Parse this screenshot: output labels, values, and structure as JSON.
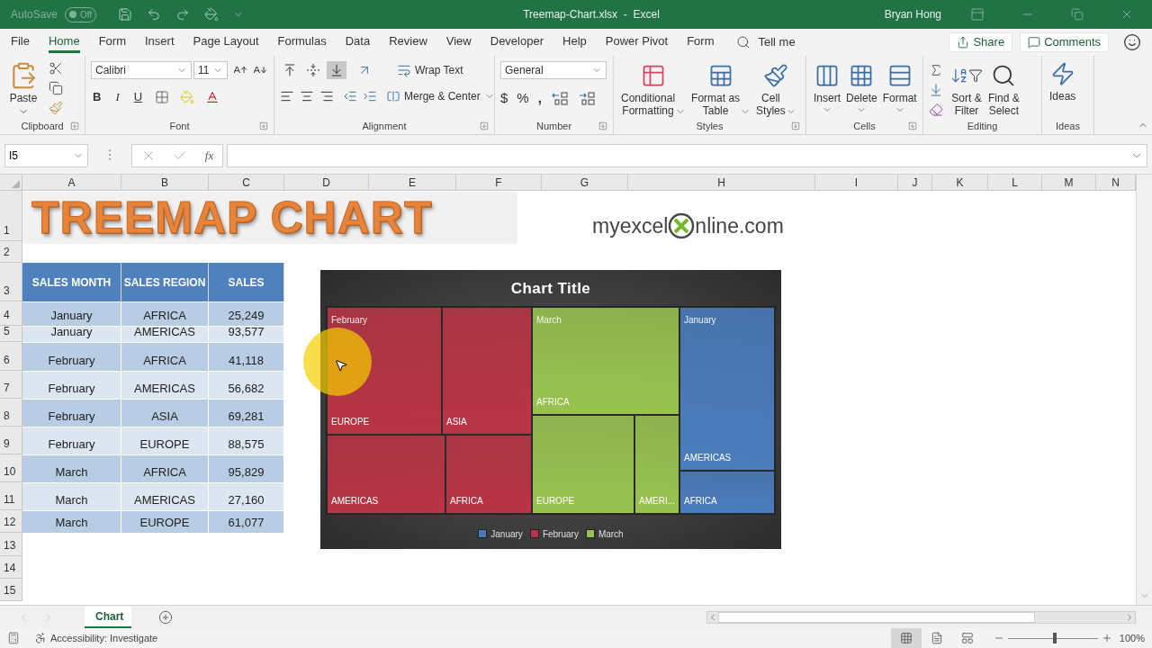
{
  "title_bar": {
    "autosave_label": "AutoSave",
    "autosave_toggle": {
      "text": "Off",
      "on": false
    },
    "title": "Treemap-Chart.xlsx  -  Excel",
    "user": "Bryan Hong"
  },
  "tabs": [
    {
      "label": "File",
      "selected": false
    },
    {
      "label": "Home",
      "selected": true
    },
    {
      "label": "Form",
      "selected": false
    },
    {
      "label": "Insert",
      "selected": false
    },
    {
      "label": "Page Layout",
      "selected": false
    },
    {
      "label": "Formulas",
      "selected": false
    },
    {
      "label": "Data",
      "selected": false
    },
    {
      "label": "Review",
      "selected": false
    },
    {
      "label": "View",
      "selected": false
    },
    {
      "label": "Developer",
      "selected": false
    },
    {
      "label": "Help",
      "selected": false
    },
    {
      "label": "Power Pivot",
      "selected": false
    },
    {
      "label": "Form",
      "selected": false
    }
  ],
  "tell_me": "Tell me",
  "share": "Share",
  "comments": "Comments",
  "ribbon": {
    "clipboard": {
      "paste": "Paste",
      "label": "Clipboard"
    },
    "font": {
      "name": "Calibri",
      "size": "11",
      "bold": "B",
      "italic": "I",
      "underline": "U",
      "label": "Font"
    },
    "alignment": {
      "valign_buttons": [
        {
          "selected": false
        },
        {
          "selected": false
        },
        {
          "selected": true
        }
      ],
      "wrap": "Wrap Text",
      "merge": "Merge & Center",
      "label": "Alignment"
    },
    "number": {
      "format": "General",
      "currency": "$",
      "percent": "%",
      "comma": ",",
      "label": "Number"
    },
    "styles": {
      "buttons": [
        "Conditional\nFormatting",
        "Format as\nTable",
        "Cell\nStyles"
      ],
      "label": "Styles"
    },
    "cells": {
      "buttons": [
        "Insert",
        "Delete",
        "Format"
      ],
      "label": "Cells"
    },
    "editing": {
      "buttons": [
        "Sort &\nFilter",
        "Find &\nSelect"
      ],
      "label": "Editing"
    },
    "ideas": {
      "button": "Ideas",
      "label": "Ideas"
    }
  },
  "formula_bar": {
    "name_box": "I5",
    "fx": "fx"
  },
  "columns": [
    "A",
    "B",
    "C",
    "D",
    "E",
    "F",
    "G",
    "H",
    "I",
    "J",
    "K",
    "L",
    "M",
    "N"
  ],
  "row_numbers": [
    "1",
    "2",
    "3",
    "4",
    "5",
    "6",
    "7",
    "8",
    "9",
    "10",
    "11",
    "12",
    "13",
    "14",
    "15"
  ],
  "banner": "TREEMAP CHART",
  "logo": {
    "left": "myexcel",
    "right": "nline.com"
  },
  "table": {
    "columns": [
      "SALES MONTH",
      "SALES REGION",
      "SALES"
    ],
    "rows": [
      [
        "January",
        "AFRICA",
        "25,249"
      ],
      [
        "January",
        "AMERICAS",
        "93,577"
      ],
      [
        "February",
        "AFRICA",
        "41,118"
      ],
      [
        "February",
        "AMERICAS",
        "56,682"
      ],
      [
        "February",
        "ASIA",
        "69,281"
      ],
      [
        "February",
        "EUROPE",
        "88,575"
      ],
      [
        "March",
        "AFRICA",
        "95,829"
      ],
      [
        "March",
        "AMERICAS",
        "27,160"
      ],
      [
        "March",
        "EUROPE",
        "61,077"
      ]
    ]
  },
  "chart": {
    "title": "Chart Title",
    "groups": [
      {
        "label": "February",
        "color": "#b93444",
        "tiles": [
          "EUROPE",
          "ASIA",
          "AMERICAS",
          "AFRICA"
        ]
      },
      {
        "label": "March",
        "color": "#98c24f",
        "tiles": [
          "AFRICA",
          "EUROPE",
          "AMERI..."
        ]
      },
      {
        "label": "January",
        "color": "#4a7cbd",
        "tiles": [
          "AMERICAS",
          "AFRICA"
        ]
      }
    ],
    "legend": [
      {
        "label": "January",
        "color": "#4a7cbd"
      },
      {
        "label": "February",
        "color": "#b93444"
      },
      {
        "label": "March",
        "color": "#98c24f"
      }
    ]
  },
  "sheet_tabs": [
    {
      "label": "Chart",
      "selected": true
    }
  ],
  "status_bar": {
    "accessibility": "Accessibility: Investigate",
    "views": [
      {
        "selected": true
      },
      {
        "selected": false
      },
      {
        "selected": false
      }
    ],
    "zoom": {
      "level": 0.52
    },
    "zoom_text": "100%"
  }
}
